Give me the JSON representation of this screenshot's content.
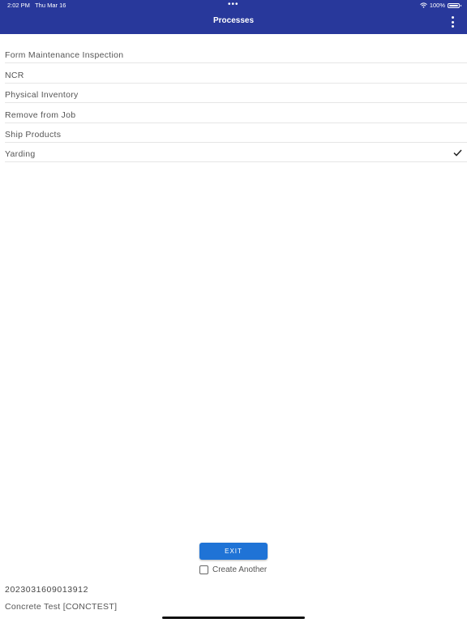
{
  "status_bar": {
    "time": "2:02 PM",
    "date": "Thu Mar 16",
    "battery": "100%",
    "dots": "•••"
  },
  "header": {
    "title": "Processes"
  },
  "processes": [
    {
      "label": "Form Maintenance Inspection",
      "selected": false
    },
    {
      "label": "NCR",
      "selected": false
    },
    {
      "label": "Physical Inventory",
      "selected": false
    },
    {
      "label": "Remove from Job",
      "selected": false
    },
    {
      "label": "Ship Products",
      "selected": false
    },
    {
      "label": "Yarding",
      "selected": true
    }
  ],
  "footer": {
    "exit_label": "EXIT",
    "create_another_label": "Create Another",
    "create_another_checked": false,
    "record_id": "2023031609013912",
    "record_name": "Concrete Test [CONCTEST]"
  },
  "colors": {
    "header_bg": "#28389b",
    "accent": "#1f73d6"
  },
  "icons": [
    "wifi-icon",
    "battery-icon",
    "more-vert-icon",
    "check-icon"
  ]
}
